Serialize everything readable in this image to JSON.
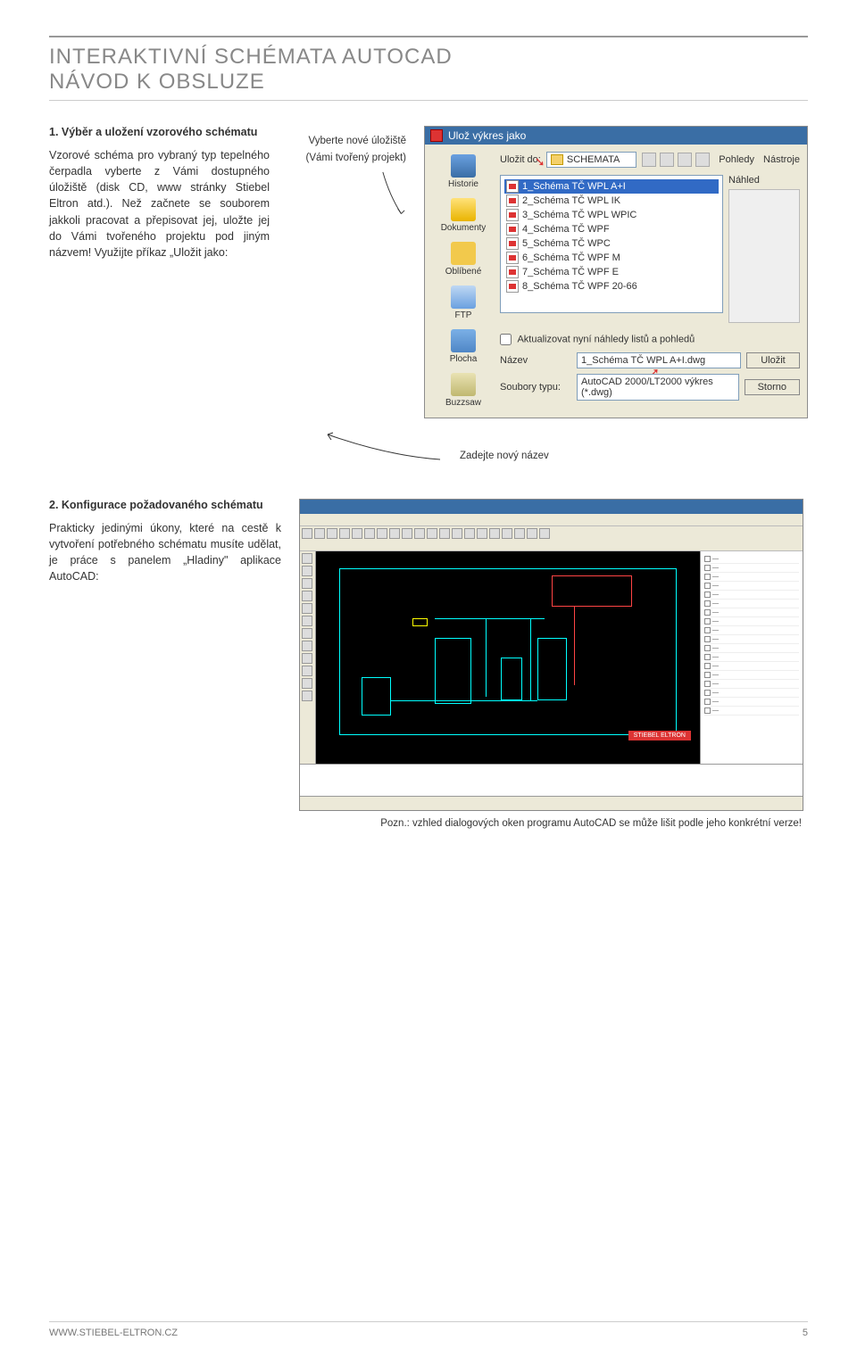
{
  "header": {
    "title1": "INTERAKTIVNÍ SCHÉMATA AUTOCAD",
    "title2": "NÁVOD K OBSLUZE"
  },
  "section1": {
    "title": "1. Výběr a uložení vzorového schématu",
    "body": "Vzorové schéma pro vybraný typ tepelného čerpadla vyberte z Vámi dostupného úložiště (disk CD, www stránky Stiebel Eltron atd.). Než začnete se souborem jakkoli pracovat a přepisovat jej, uložte jej do Vámi tvořeného projektu pod jiným názvem! Využijte příkaz „Uložit jako:",
    "annot_top_line1": "Vyberte nové úložiště",
    "annot_top_line2": "(Vámi tvořený projekt)",
    "annot_bottom": "Zadejte nový název"
  },
  "dialog": {
    "title": "Ulož výkres jako",
    "save_to_label": "Uložit do:",
    "folder": "SCHEMATA",
    "toollabel_views": "Pohledy",
    "toollabel_tools": "Nástroje",
    "preview_label": "Náhled",
    "places": [
      {
        "label": "Historie",
        "cls": "pic-blue"
      },
      {
        "label": "Dokumenty",
        "cls": "pic-yellow"
      },
      {
        "label": "Oblíbené",
        "cls": "pic-star"
      },
      {
        "label": "FTP",
        "cls": "pic-ftp"
      },
      {
        "label": "Plocha",
        "cls": "pic-desk"
      },
      {
        "label": "Buzzsaw",
        "cls": "pic-buzz"
      }
    ],
    "files": [
      "1_Schéma TČ WPL A+I",
      "2_Schéma TČ WPL IK",
      "3_Schéma TČ WPL WPIC",
      "4_Schéma TČ WPF",
      "5_Schéma TČ WPC",
      "6_Schéma TČ WPF M",
      "7_Schéma TČ WPF E",
      "8_Schéma TČ WPF 20-66"
    ],
    "checkbox_label": "Aktualizovat nyní náhledy listů a pohledů",
    "name_label": "Název",
    "name_value": "1_Schéma TČ WPL A+I.dwg",
    "filetype_label": "Soubory typu:",
    "filetype_value": "AutoCAD 2000/LT2000 výkres (*.dwg)",
    "btn_save": "Uložit",
    "btn_cancel": "Storno"
  },
  "section2": {
    "title": "2. Konfigurace požadovaného schématu",
    "body": "Prakticky jedinými úkony, které na cestě k vytvoření potřebného schématu musíte udělat, je práce s panelem „Hladiny\" aplikace AutoCAD:",
    "note": "Pozn.: vzhled dialogových oken programu AutoCAD se může lišit podle jeho konkrétní verze!"
  },
  "autocad": {
    "brand": "STIEBEL ELTRON"
  },
  "footer": {
    "url": "WWW.STIEBEL-ELTRON.CZ",
    "page": "5"
  }
}
